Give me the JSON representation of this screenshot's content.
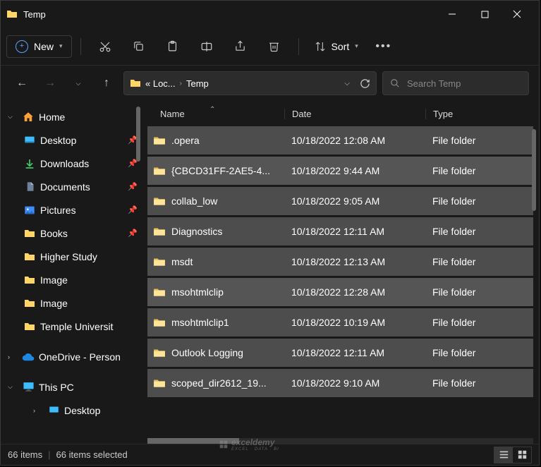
{
  "title": "Temp",
  "toolbar": {
    "new_label": "New",
    "sort_label": "Sort"
  },
  "address": {
    "crumb1": "« Loc...",
    "crumb2": "Temp"
  },
  "search": {
    "placeholder": "Search Temp"
  },
  "sidebar": {
    "home": "Home",
    "desktop": "Desktop",
    "downloads": "Downloads",
    "documents": "Documents",
    "pictures": "Pictures",
    "books": "Books",
    "higherstudy": "Higher Study",
    "image1": "Image",
    "image2": "Image",
    "temple": "Temple Universit",
    "onedrive": "OneDrive - Person",
    "thispc": "This PC",
    "desktop2": "Desktop"
  },
  "columns": {
    "name": "Name",
    "date": "Date",
    "type": "Type"
  },
  "rows": [
    {
      "name": ".opera",
      "date": "10/18/2022 12:08 AM",
      "type": "File folder"
    },
    {
      "name": "{CBCD31FF-2AE5-4...",
      "date": "10/18/2022 9:44 AM",
      "type": "File folder"
    },
    {
      "name": "collab_low",
      "date": "10/18/2022 9:05 AM",
      "type": "File folder"
    },
    {
      "name": "Diagnostics",
      "date": "10/18/2022 12:11 AM",
      "type": "File folder"
    },
    {
      "name": "msdt",
      "date": "10/18/2022 12:13 AM",
      "type": "File folder"
    },
    {
      "name": "msohtmlclip",
      "date": "10/18/2022 12:28 AM",
      "type": "File folder"
    },
    {
      "name": "msohtmlclip1",
      "date": "10/18/2022 10:19 AM",
      "type": "File folder"
    },
    {
      "name": "Outlook Logging",
      "date": "10/18/2022 12:11 AM",
      "type": "File folder"
    },
    {
      "name": "scoped_dir2612_19...",
      "date": "10/18/2022 9:10 AM",
      "type": "File folder"
    }
  ],
  "status": {
    "items": "66 items",
    "selected": "66 items selected"
  },
  "watermark": {
    "brand": "exceldemy",
    "sub": "EXCEL · DATA · BI"
  }
}
